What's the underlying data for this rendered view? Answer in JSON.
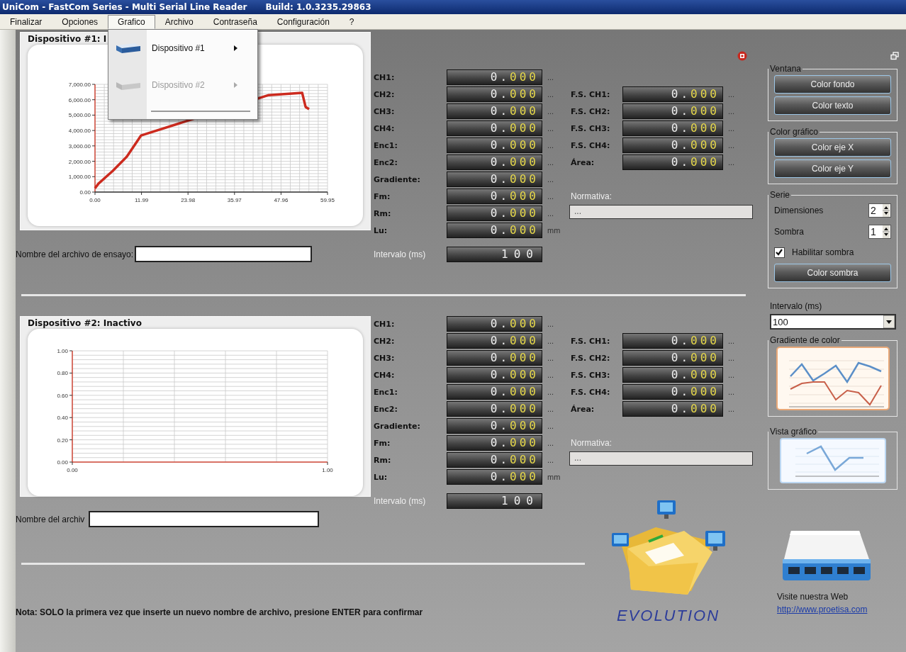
{
  "window": {
    "title": "UniCom - FastCom Series - Multi Serial Line Reader",
    "build": "Build: 1.0.3235.29863"
  },
  "menu": [
    {
      "label": "Finalizar",
      "selected": false
    },
    {
      "label": "Opciones",
      "selected": false
    },
    {
      "label": "Grafico",
      "selected": true
    },
    {
      "label": "Archivo",
      "selected": false
    },
    {
      "label": "Contraseña",
      "selected": false
    },
    {
      "label": "Configuración",
      "selected": false
    },
    {
      "label": "?",
      "selected": false
    }
  ],
  "dropdown": [
    {
      "label": "Dispositivo #1",
      "disabled": false
    },
    {
      "label": "Dispositivo #2",
      "disabled": true
    }
  ],
  "devices": [
    {
      "title": "Dispositivo #1: I",
      "chart_data": {
        "type": "line",
        "grid": true,
        "x": [
          0,
          0.9,
          4.6,
          8.2,
          11.9,
          44.8,
          53.4,
          54.3,
          55.2
        ],
        "series": [
          {
            "color": "#cc2a1e",
            "values": [
              250,
              550,
              1380,
              2300,
              3680,
              6300,
              6450,
              5530,
              5390
            ]
          }
        ],
        "xlim": [
          0,
          59.95
        ],
        "ylim": [
          0,
          7000
        ],
        "xticks": [
          {
            "value": 0,
            "label": "0.00"
          },
          {
            "value": 11.99,
            "label": "11.99"
          },
          {
            "value": 23.98,
            "label": "23.98"
          },
          {
            "value": 35.97,
            "label": "35.97"
          },
          {
            "value": 47.96,
            "label": "47.96"
          },
          {
            "value": 59.95,
            "label": "59.95"
          }
        ],
        "yticks": [
          {
            "value": 0,
            "label": "0.00"
          },
          {
            "value": 1000,
            "label": "1,000.00"
          },
          {
            "value": 2000,
            "label": "2,000.00"
          },
          {
            "value": 3000,
            "label": "3,000.00"
          },
          {
            "value": 4000,
            "label": "4,000.00"
          },
          {
            "value": 5000,
            "label": "5,000.00"
          },
          {
            "value": 6000,
            "label": "6,000.00"
          },
          {
            "value": 7000,
            "label": "7,000.00"
          }
        ]
      },
      "file_label": "Nombre del archivo de ensayo:",
      "channels": [
        {
          "label": "CH1:",
          "value": "0.000",
          "unit": "..."
        },
        {
          "label": "CH2:",
          "value": "0.000",
          "unit": "..."
        },
        {
          "label": "CH3:",
          "value": "0.000",
          "unit": "..."
        },
        {
          "label": "CH4:",
          "value": "0.000",
          "unit": "..."
        },
        {
          "label": "Enc1:",
          "value": "0.000",
          "unit": "..."
        },
        {
          "label": "Enc2:",
          "value": "0.000",
          "unit": "..."
        },
        {
          "label": "Gradiente:",
          "value": "0.000",
          "unit": "..."
        },
        {
          "label": "Fm:",
          "value": "0.000",
          "unit": "..."
        },
        {
          "label": "Rm:",
          "value": "0.000",
          "unit": "..."
        },
        {
          "label": "Lu:",
          "value": "0.000",
          "unit": "mm"
        }
      ],
      "interval": {
        "label": "Intervalo (ms)",
        "value": "100"
      },
      "fs": [
        {
          "label": "F.S. CH1:",
          "value": "0.000",
          "unit": "..."
        },
        {
          "label": "F.S. CH2:",
          "value": "0.000",
          "unit": "..."
        },
        {
          "label": "F.S. CH3:",
          "value": "0.000",
          "unit": "..."
        },
        {
          "label": "F.S. CH4:",
          "value": "0.000",
          "unit": "..."
        },
        {
          "label": "Área:",
          "value": "0.000",
          "unit": "..."
        }
      ],
      "normativa": {
        "label": "Normativa:",
        "value": "..."
      }
    },
    {
      "title": "Dispositivo #2: Inactivo",
      "chart_data": {
        "type": "line",
        "grid": true,
        "xlim": [
          0,
          1
        ],
        "ylim": [
          0,
          1
        ],
        "xticks": [
          {
            "value": 0,
            "label": "0.00"
          },
          {
            "value": 1,
            "label": "1.00"
          }
        ],
        "yticks": [
          {
            "value": 0,
            "label": "0.00"
          },
          {
            "value": 0.2,
            "label": "0.20"
          },
          {
            "value": 0.4,
            "label": "0.40"
          },
          {
            "value": 0.6,
            "label": "0.60"
          },
          {
            "value": 0.8,
            "label": "0.80"
          },
          {
            "value": 1,
            "label": "1.00"
          }
        ]
      },
      "file_label": "Nombre del archiv",
      "channels": [
        {
          "label": "CH1:",
          "value": "0.000",
          "unit": "..."
        },
        {
          "label": "CH2:",
          "value": "0.000",
          "unit": "..."
        },
        {
          "label": "CH3:",
          "value": "0.000",
          "unit": "..."
        },
        {
          "label": "CH4:",
          "value": "0.000",
          "unit": "..."
        },
        {
          "label": "Enc1:",
          "value": "0.000",
          "unit": "..."
        },
        {
          "label": "Enc2:",
          "value": "0.000",
          "unit": "..."
        },
        {
          "label": "Gradiente:",
          "value": "0.000",
          "unit": "..."
        },
        {
          "label": "Fm:",
          "value": "0.000",
          "unit": "..."
        },
        {
          "label": "Rm:",
          "value": "0.000",
          "unit": "..."
        },
        {
          "label": "Lu:",
          "value": "0.000",
          "unit": "mm"
        }
      ],
      "interval": {
        "label": "Intervalo (ms)",
        "value": "100"
      },
      "fs": [
        {
          "label": "F.S. CH1:",
          "value": "0.000",
          "unit": "..."
        },
        {
          "label": "F.S. CH2:",
          "value": "0.000",
          "unit": "..."
        },
        {
          "label": "F.S. CH3:",
          "value": "0.000",
          "unit": "..."
        },
        {
          "label": "F.S. CH4:",
          "value": "0.000",
          "unit": "..."
        },
        {
          "label": "Área:",
          "value": "0.000",
          "unit": "..."
        }
      ],
      "normativa": {
        "label": "Normativa:",
        "value": "..."
      }
    }
  ],
  "note": "Nota: SOLO la primera vez que inserte un nuevo nombre de archivo, presione ENTER para confirmar",
  "logo_text": "EVOLUTION",
  "sidebar": {
    "groups": [
      {
        "title": "Ventana",
        "items": [
          {
            "kind": "button",
            "label": "Color fondo"
          },
          {
            "kind": "button",
            "label": "Color texto"
          }
        ]
      },
      {
        "title": "Color gráfico",
        "items": [
          {
            "kind": "button",
            "label": "Color eje X"
          },
          {
            "kind": "button",
            "label": "Color eje Y"
          }
        ]
      },
      {
        "title": "Serie",
        "items": [
          {
            "kind": "spinner",
            "label": "Dimensiones",
            "value": "2"
          },
          {
            "kind": "spinner",
            "label": "Sombra",
            "value": "1"
          },
          {
            "kind": "checkbox",
            "label": "Habilitar sombra",
            "checked": true
          },
          {
            "kind": "button",
            "label": "Color sombra"
          }
        ]
      }
    ],
    "interval": {
      "label": "Intervalo (ms)",
      "value": "100"
    },
    "previews": [
      {
        "title": "Gradiente de color",
        "kind": "gradient"
      },
      {
        "title": "Vista gráfico",
        "kind": "view"
      }
    ],
    "web_label": "Visite nuestra Web",
    "web_link": "http://www.proetisa.com"
  }
}
